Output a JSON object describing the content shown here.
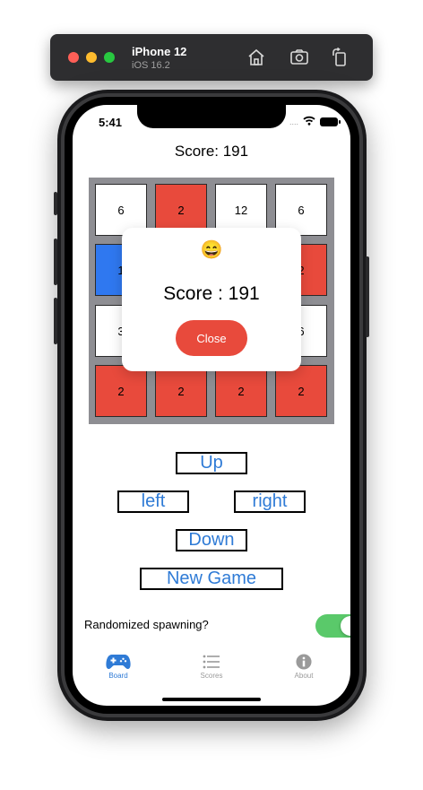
{
  "simulator": {
    "device_name": "iPhone 12",
    "os_version": "iOS 16.2",
    "icons": [
      "home-icon",
      "screenshot-icon",
      "rotate-icon"
    ]
  },
  "status_bar": {
    "time": "5:41",
    "signal": "....",
    "icons": [
      "wifi-icon",
      "battery-icon"
    ]
  },
  "header": {
    "score_label": "Score: 191"
  },
  "board": {
    "tiles": [
      {
        "value": "6",
        "color": "white"
      },
      {
        "value": "2",
        "color": "red"
      },
      {
        "value": "12",
        "color": "white"
      },
      {
        "value": "6",
        "color": "white"
      },
      {
        "value": "1",
        "color": "blue"
      },
      {
        "value": "",
        "color": "white"
      },
      {
        "value": "",
        "color": "white"
      },
      {
        "value": "2",
        "color": "red"
      },
      {
        "value": "3",
        "color": "white"
      },
      {
        "value": "",
        "color": "white"
      },
      {
        "value": "",
        "color": "white"
      },
      {
        "value": "6",
        "color": "white"
      },
      {
        "value": "2",
        "color": "red"
      },
      {
        "value": "2",
        "color": "red"
      },
      {
        "value": "2",
        "color": "red"
      },
      {
        "value": "2",
        "color": "red"
      }
    ],
    "colors": {
      "white": "#ffffff",
      "red": "#e84a3c",
      "blue": "#2f78f0",
      "grid": "#8e8e93"
    }
  },
  "popup": {
    "emoji": "😄",
    "score_text": "Score : 191",
    "close_label": "Close",
    "close_color": "#e84a3c"
  },
  "controls": {
    "up": "Up",
    "left": "left",
    "right": "right",
    "down": "Down",
    "new_game": "New Game",
    "text_color": "#2f7bd6"
  },
  "settings": {
    "randomized_label": "Randomized spawning?",
    "randomized_on": true,
    "toggle_color": "#5ac96a"
  },
  "tabbar": {
    "items": [
      {
        "label": "Board",
        "icon": "gamecontroller-icon",
        "active": true
      },
      {
        "label": "Scores",
        "icon": "list-icon",
        "active": false
      },
      {
        "label": "About",
        "icon": "info-icon",
        "active": false
      }
    ],
    "active_color": "#2f7bd6",
    "inactive_color": "#9a9a9a"
  }
}
